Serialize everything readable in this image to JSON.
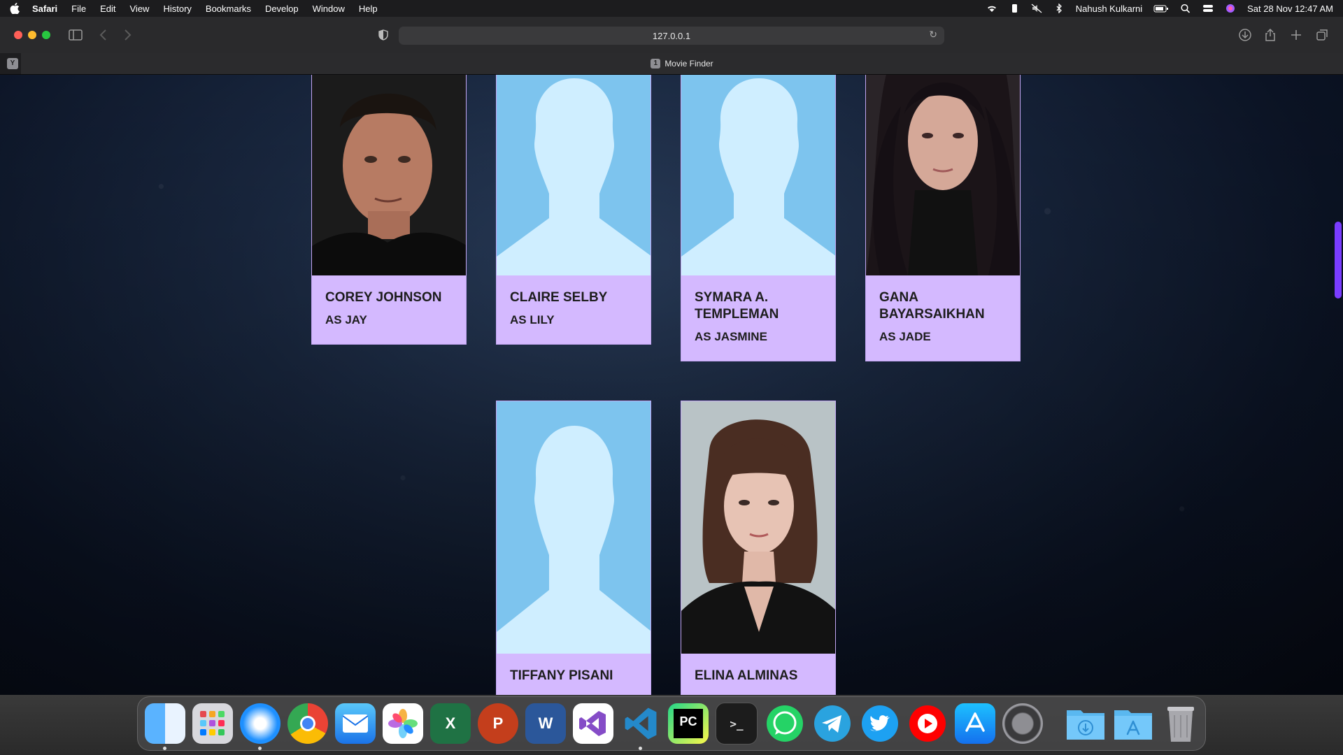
{
  "menubar": {
    "app_name": "Safari",
    "items": [
      "File",
      "Edit",
      "View",
      "History",
      "Bookmarks",
      "Develop",
      "Window",
      "Help"
    ],
    "user": "Nahush Kulkarni",
    "datetime": "Sat 28 Nov  12:47 AM"
  },
  "browser": {
    "url": "127.0.0.1",
    "tab_title": "Movie Finder",
    "tab_badge": "1",
    "left_tab_letter": "Y"
  },
  "cast": [
    {
      "name": "COREY JOHNSON",
      "role": "AS JAY",
      "photo": "actor-photo-man"
    },
    {
      "name": "CLAIRE SELBY",
      "role": "AS LILY",
      "photo": "placeholder-avatar"
    },
    {
      "name": "SYMARA A. TEMPLEMAN",
      "role": "AS JASMINE",
      "photo": "placeholder-avatar"
    },
    {
      "name": "GANA BAYARSAIKHAN",
      "role": "AS JADE",
      "photo": "actor-photo-woman-dark-hair"
    },
    {
      "name": "TIFFANY PISANI",
      "role": "",
      "photo": "placeholder-avatar"
    },
    {
      "name": "ELINA ALMINAS",
      "role": "",
      "photo": "actor-photo-woman-bangs"
    }
  ],
  "dock": {
    "apps": [
      "Finder",
      "Launchpad",
      "Safari",
      "Chrome",
      "Mail",
      "Photos",
      "Excel",
      "PowerPoint",
      "Word",
      "Visual Studio",
      "VS Code",
      "PyCharm",
      "Terminal",
      "WhatsApp",
      "Telegram",
      "Twitter",
      "YouTube",
      "App Store",
      "System Preferences"
    ],
    "folders": [
      "Downloads",
      "Applications"
    ],
    "trash": "Trash"
  },
  "colors": {
    "card_bg": "#d4b9ff",
    "placeholder_bg": "#7dc4ee",
    "placeholder_silhouette": "#cfeeff",
    "scroll_thumb": "#7a3cff"
  }
}
